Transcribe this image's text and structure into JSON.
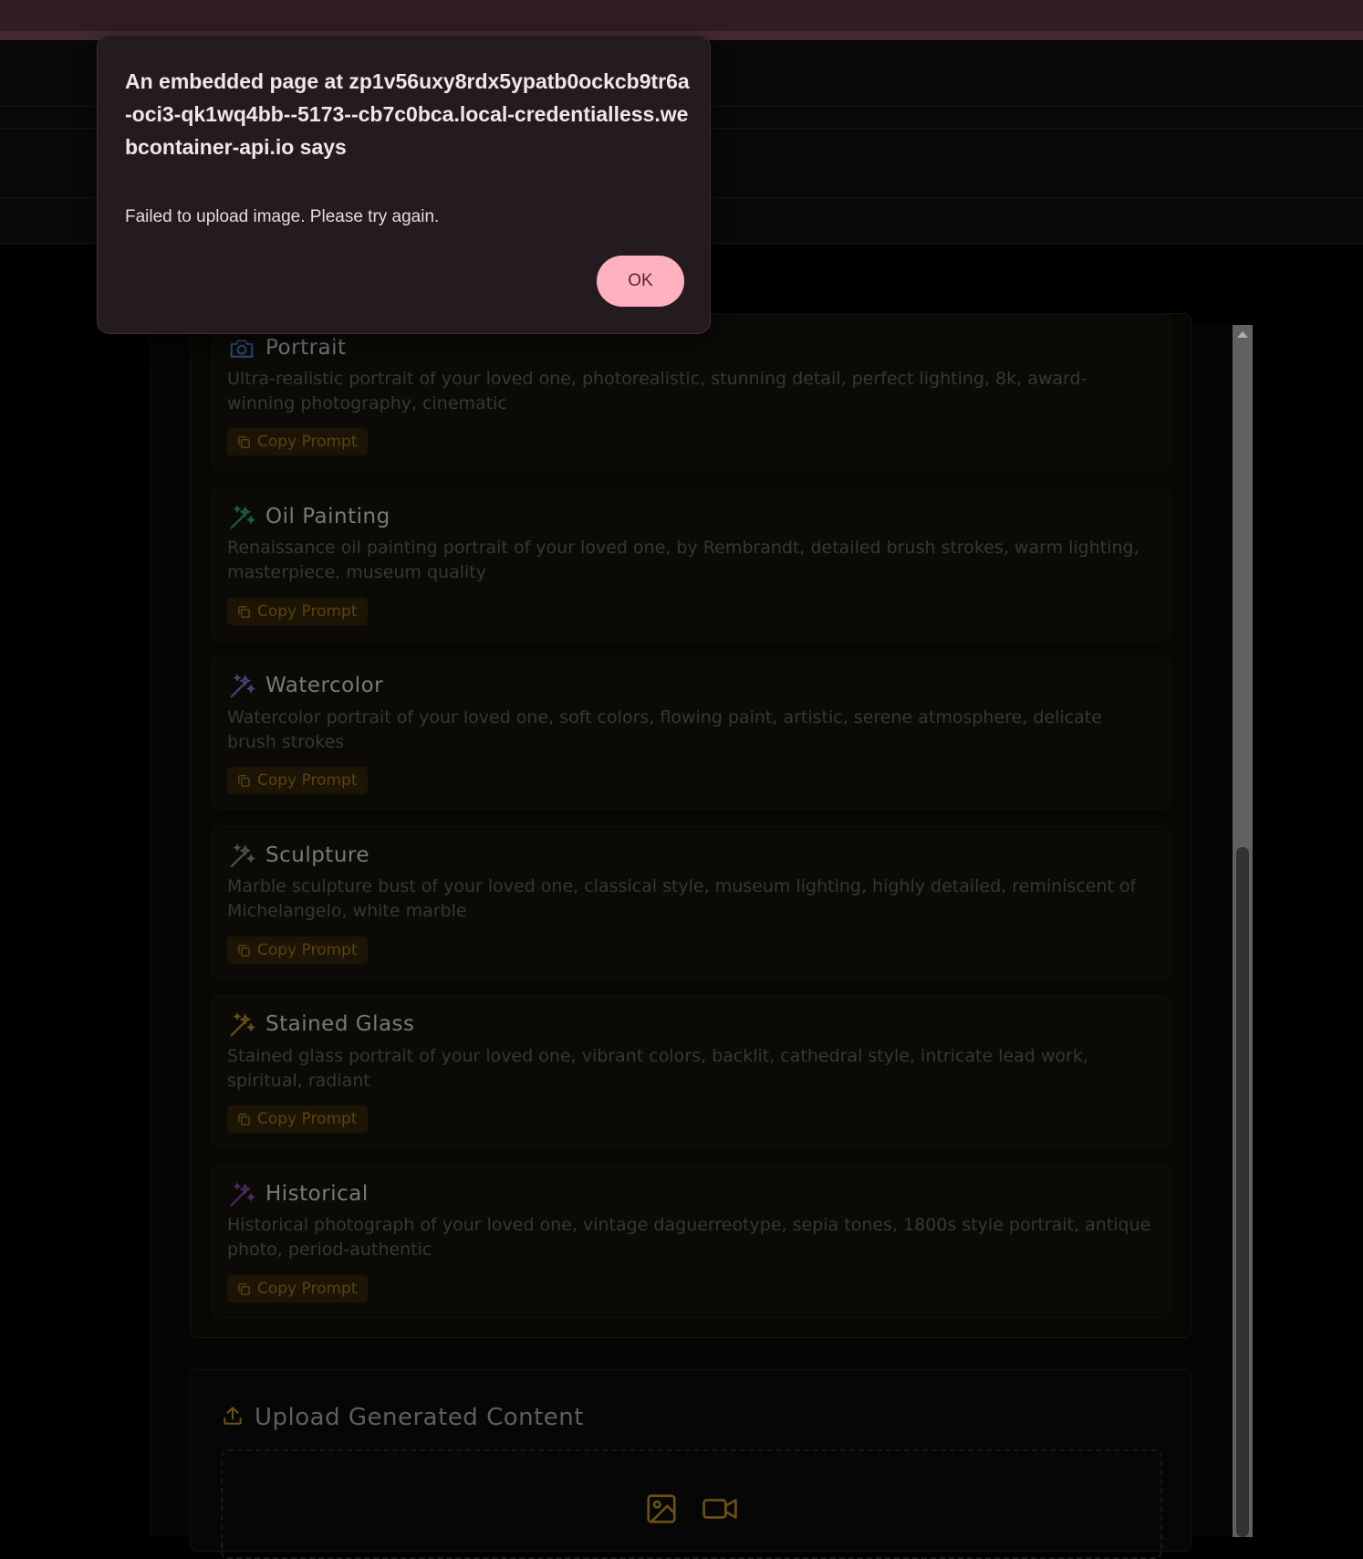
{
  "dialog": {
    "title": "An embedded page at zp1v56uxy8rdx5ypatb0ockcb9tr6a-oci3-qk1wq4bb--5173--cb7c0bca.local-credentialless.webcontainer-api.io says",
    "message": "Failed to upload image. Please try again.",
    "ok_label": "OK"
  },
  "prompts": [
    {
      "icon": "camera-icon",
      "icon_color": "#2f4f7a",
      "title": "Portrait",
      "description": "Ultra-realistic portrait of your loved one, photorealistic, stunning detail, perfect lighting, 8k, award-winning photography, cinematic",
      "copy_label": "Copy Prompt"
    },
    {
      "icon": "magic-wand-icon",
      "icon_color": "#1f6b4f",
      "title": "Oil Painting",
      "description": "Renaissance oil painting portrait of your loved one, by Rembrandt, detailed brush strokes, warm lighting, masterpiece, museum quality",
      "copy_label": "Copy Prompt"
    },
    {
      "icon": "magic-wand-icon",
      "icon_color": "#4c4f8a",
      "title": "Watercolor",
      "description": "Watercolor portrait of your loved one, soft colors, flowing paint, artistic, serene atmosphere, delicate brush strokes",
      "copy_label": "Copy Prompt"
    },
    {
      "icon": "magic-wand-icon",
      "icon_color": "#5a5a5a",
      "title": "Sculpture",
      "description": "Marble sculpture bust of your loved one, classical style, museum lighting, highly detailed, reminiscent of Michelangelo, white marble",
      "copy_label": "Copy Prompt"
    },
    {
      "icon": "magic-wand-icon",
      "icon_color": "#7a5a16",
      "title": "Stained Glass",
      "description": "Stained glass portrait of your loved one, vibrant colors, backlit, cathedral style, intricate lead work, spiritual, radiant",
      "copy_label": "Copy Prompt"
    },
    {
      "icon": "magic-wand-icon",
      "icon_color": "#5a2f6e",
      "title": "Historical",
      "description": "Historical photograph of your loved one, vintage daguerreotype, sepia tones, 1800s style portrait, antique photo, period-authentic",
      "copy_label": "Copy Prompt"
    }
  ],
  "upload": {
    "title": "Upload Generated Content",
    "icon_color": "#7a5a16"
  }
}
